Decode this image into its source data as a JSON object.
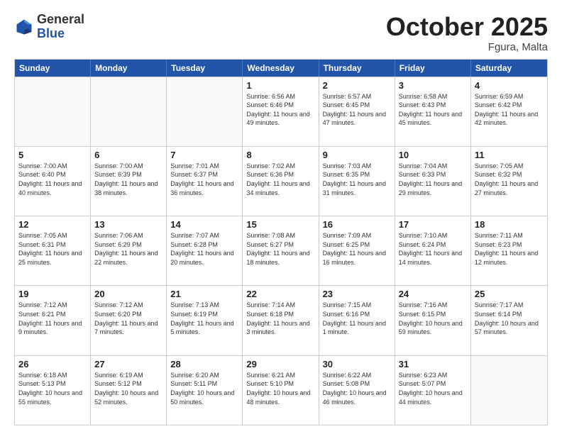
{
  "header": {
    "logo_general": "General",
    "logo_blue": "Blue",
    "month_title": "October 2025",
    "location": "Fgura, Malta"
  },
  "days_of_week": [
    "Sunday",
    "Monday",
    "Tuesday",
    "Wednesday",
    "Thursday",
    "Friday",
    "Saturday"
  ],
  "rows": [
    [
      {
        "day": "",
        "info": ""
      },
      {
        "day": "",
        "info": ""
      },
      {
        "day": "",
        "info": ""
      },
      {
        "day": "1",
        "info": "Sunrise: 6:56 AM\nSunset: 6:46 PM\nDaylight: 11 hours and 49 minutes."
      },
      {
        "day": "2",
        "info": "Sunrise: 6:57 AM\nSunset: 6:45 PM\nDaylight: 11 hours and 47 minutes."
      },
      {
        "day": "3",
        "info": "Sunrise: 6:58 AM\nSunset: 6:43 PM\nDaylight: 11 hours and 45 minutes."
      },
      {
        "day": "4",
        "info": "Sunrise: 6:59 AM\nSunset: 6:42 PM\nDaylight: 11 hours and 42 minutes."
      }
    ],
    [
      {
        "day": "5",
        "info": "Sunrise: 7:00 AM\nSunset: 6:40 PM\nDaylight: 11 hours and 40 minutes."
      },
      {
        "day": "6",
        "info": "Sunrise: 7:00 AM\nSunset: 6:39 PM\nDaylight: 11 hours and 38 minutes."
      },
      {
        "day": "7",
        "info": "Sunrise: 7:01 AM\nSunset: 6:37 PM\nDaylight: 11 hours and 36 minutes."
      },
      {
        "day": "8",
        "info": "Sunrise: 7:02 AM\nSunset: 6:36 PM\nDaylight: 11 hours and 34 minutes."
      },
      {
        "day": "9",
        "info": "Sunrise: 7:03 AM\nSunset: 6:35 PM\nDaylight: 11 hours and 31 minutes."
      },
      {
        "day": "10",
        "info": "Sunrise: 7:04 AM\nSunset: 6:33 PM\nDaylight: 11 hours and 29 minutes."
      },
      {
        "day": "11",
        "info": "Sunrise: 7:05 AM\nSunset: 6:32 PM\nDaylight: 11 hours and 27 minutes."
      }
    ],
    [
      {
        "day": "12",
        "info": "Sunrise: 7:05 AM\nSunset: 6:31 PM\nDaylight: 11 hours and 25 minutes."
      },
      {
        "day": "13",
        "info": "Sunrise: 7:06 AM\nSunset: 6:29 PM\nDaylight: 11 hours and 22 minutes."
      },
      {
        "day": "14",
        "info": "Sunrise: 7:07 AM\nSunset: 6:28 PM\nDaylight: 11 hours and 20 minutes."
      },
      {
        "day": "15",
        "info": "Sunrise: 7:08 AM\nSunset: 6:27 PM\nDaylight: 11 hours and 18 minutes."
      },
      {
        "day": "16",
        "info": "Sunrise: 7:09 AM\nSunset: 6:25 PM\nDaylight: 11 hours and 16 minutes."
      },
      {
        "day": "17",
        "info": "Sunrise: 7:10 AM\nSunset: 6:24 PM\nDaylight: 11 hours and 14 minutes."
      },
      {
        "day": "18",
        "info": "Sunrise: 7:11 AM\nSunset: 6:23 PM\nDaylight: 11 hours and 12 minutes."
      }
    ],
    [
      {
        "day": "19",
        "info": "Sunrise: 7:12 AM\nSunset: 6:21 PM\nDaylight: 11 hours and 9 minutes."
      },
      {
        "day": "20",
        "info": "Sunrise: 7:12 AM\nSunset: 6:20 PM\nDaylight: 11 hours and 7 minutes."
      },
      {
        "day": "21",
        "info": "Sunrise: 7:13 AM\nSunset: 6:19 PM\nDaylight: 11 hours and 5 minutes."
      },
      {
        "day": "22",
        "info": "Sunrise: 7:14 AM\nSunset: 6:18 PM\nDaylight: 11 hours and 3 minutes."
      },
      {
        "day": "23",
        "info": "Sunrise: 7:15 AM\nSunset: 6:16 PM\nDaylight: 11 hours and 1 minute."
      },
      {
        "day": "24",
        "info": "Sunrise: 7:16 AM\nSunset: 6:15 PM\nDaylight: 10 hours and 59 minutes."
      },
      {
        "day": "25",
        "info": "Sunrise: 7:17 AM\nSunset: 6:14 PM\nDaylight: 10 hours and 57 minutes."
      }
    ],
    [
      {
        "day": "26",
        "info": "Sunrise: 6:18 AM\nSunset: 5:13 PM\nDaylight: 10 hours and 55 minutes."
      },
      {
        "day": "27",
        "info": "Sunrise: 6:19 AM\nSunset: 5:12 PM\nDaylight: 10 hours and 52 minutes."
      },
      {
        "day": "28",
        "info": "Sunrise: 6:20 AM\nSunset: 5:11 PM\nDaylight: 10 hours and 50 minutes."
      },
      {
        "day": "29",
        "info": "Sunrise: 6:21 AM\nSunset: 5:10 PM\nDaylight: 10 hours and 48 minutes."
      },
      {
        "day": "30",
        "info": "Sunrise: 6:22 AM\nSunset: 5:08 PM\nDaylight: 10 hours and 46 minutes."
      },
      {
        "day": "31",
        "info": "Sunrise: 6:23 AM\nSunset: 5:07 PM\nDaylight: 10 hours and 44 minutes."
      },
      {
        "day": "",
        "info": ""
      }
    ]
  ]
}
